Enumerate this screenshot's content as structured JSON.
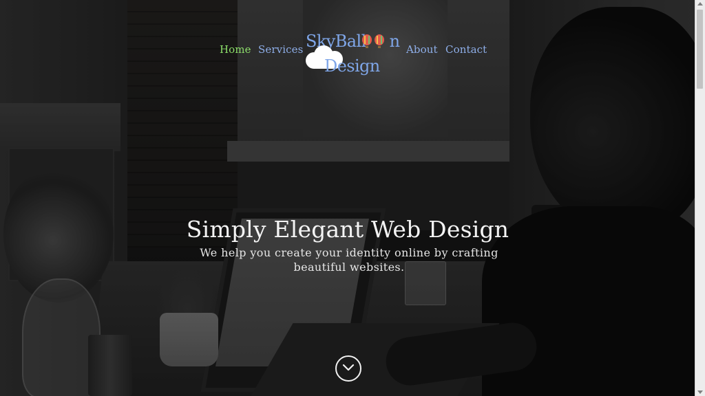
{
  "nav": {
    "items": [
      {
        "label": "Home",
        "active": true
      },
      {
        "label": "Services",
        "active": false
      },
      {
        "label": "About",
        "active": false
      },
      {
        "label": "Contact",
        "active": false
      }
    ]
  },
  "logo": {
    "line1": "SkyBall",
    "line1_end": "n",
    "line2": "Design",
    "icons": [
      "cloud-icon",
      "hot-air-balloon-icon"
    ]
  },
  "hero": {
    "title": "Simply Elegant Web Design",
    "subtitle": "We help you create your identity online by crafting beautiful websites."
  },
  "scroll_button": {
    "icon": "chevron-down-icon"
  },
  "colors": {
    "nav_link": "#8eaee8",
    "nav_active": "#8ee06b",
    "logo": "#7fa6e8",
    "hero_text": "#f4f4f4"
  }
}
